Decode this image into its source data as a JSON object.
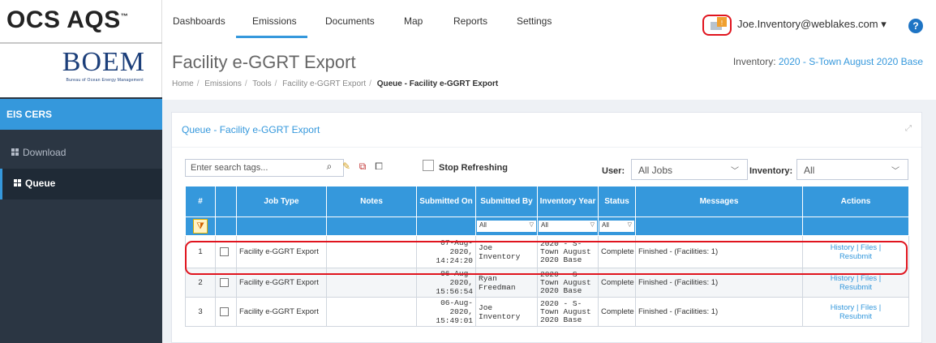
{
  "logo": {
    "product": "OCS AQS",
    "tm": "™",
    "agency": "BOEM",
    "agency_sub": "Bureau of Ocean Energy Management"
  },
  "sidebar": {
    "section": "EIS CERS",
    "items": [
      {
        "label": "Download",
        "icon": "grid-icon"
      },
      {
        "label": "Queue",
        "icon": "grid-icon",
        "active": true
      }
    ]
  },
  "nav": {
    "items": [
      "Dashboards",
      "Emissions",
      "Documents",
      "Map",
      "Reports",
      "Settings"
    ],
    "active": "Emissions",
    "user": "Joe.Inventory@weblakes.com",
    "user_caret": "▾",
    "help": "?"
  },
  "page": {
    "title": "Facility e-GGRT Export",
    "inventory_label": "Inventory:",
    "inventory_value": "2020 - S-Town August 2020 Base",
    "breadcrumb": [
      "Home",
      "Emissions",
      "Tools",
      "Facility e-GGRT Export",
      "Queue - Facility e-GGRT Export"
    ],
    "breadcrumb_sep": "/"
  },
  "portlet": {
    "title": "Queue - Facility e-GGRT Export",
    "search_placeholder": "Enter search tags...",
    "stop_refreshing": "Stop Refreshing",
    "user_label": "User:",
    "user_value": "All Jobs",
    "inventory_label": "Inventory:",
    "inventory_value": "All"
  },
  "table": {
    "headers": [
      "#",
      "",
      "Job Type",
      "Notes",
      "Submitted On",
      "Submitted By",
      "Inventory Year",
      "Status",
      "Messages",
      "Actions"
    ],
    "filter_all": "All",
    "rows": [
      {
        "num": "1",
        "job_type": "Facility e-GGRT Export",
        "notes": "",
        "date": "07-Aug-2020,",
        "time": "14:24:20",
        "by": "Joe Inventory",
        "year": "2020 - S-Town August 2020 Base",
        "status": "Complete",
        "message": "Finished - (Facilities: 1)",
        "actions_1": "History | Files |",
        "actions_2": "Resubmit"
      },
      {
        "num": "2",
        "job_type": "Facility e-GGRT Export",
        "notes": "",
        "date": "06-Aug-2020,",
        "time": "15:56:54",
        "by": "Ryan Freedman",
        "year": "2020 - S-Town August 2020 Base",
        "status": "Complete",
        "message": "Finished - (Facilities: 1)",
        "actions_1": "History | Files |",
        "actions_2": "Resubmit"
      },
      {
        "num": "3",
        "job_type": "Facility e-GGRT Export",
        "notes": "",
        "date": "06-Aug-2020,",
        "time": "15:49:01",
        "by": "Joe Inventory",
        "year": "2020 - S-Town August 2020 Base",
        "status": "Complete",
        "message": "Finished - (Facilities: 1)",
        "actions_1": "History | Files |",
        "actions_2": "Resubmit"
      }
    ]
  },
  "colors": {
    "accent": "#3598dc",
    "sidebar": "#2b3643",
    "highlight": "#e0141e"
  }
}
